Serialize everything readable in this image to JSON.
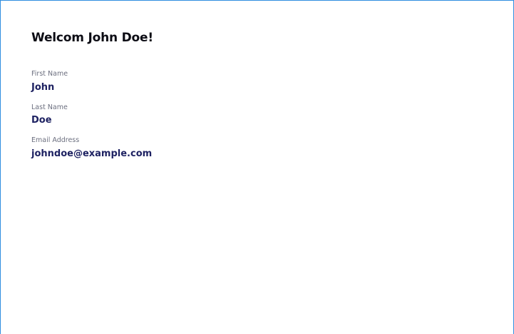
{
  "profile": {
    "title": "Welcom John Doe!",
    "fields": [
      {
        "label": "First Name",
        "value": "John"
      },
      {
        "label": "Last Name",
        "value": "Doe"
      },
      {
        "label": "Email Address",
        "value": "johndoe@example.com"
      }
    ]
  },
  "colors": {
    "frame_border": "#2f8ee0",
    "title": "#0c0c14",
    "label": "#6c6f7f",
    "value": "#1e2262"
  }
}
